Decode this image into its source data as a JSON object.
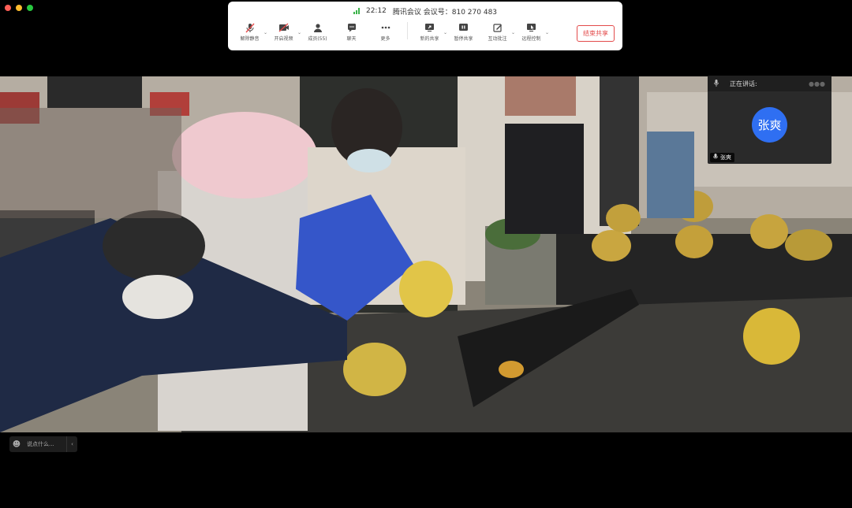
{
  "toolbar": {
    "time": "22:12",
    "meeting_label": "腾讯会议 会议号：810 270 483",
    "buttons": {
      "mute": "解除静音",
      "video": "开启视频",
      "members": "成员(55)",
      "chat": "聊天",
      "more": "更多",
      "share": "新的共享",
      "pause_share": "暂停共享",
      "annotate": "互动批注",
      "remote": "远程控制"
    },
    "end_label": "结束共享"
  },
  "speaker_panel": {
    "title": "正在讲话:",
    "avatar_text": "张爽",
    "name": "张爽"
  },
  "chat": {
    "placeholder": "说点什么..."
  },
  "colors": {
    "accent_blue": "#2f6ff2",
    "end_red": "#e34b4b",
    "signal_green": "#3bb34a"
  }
}
